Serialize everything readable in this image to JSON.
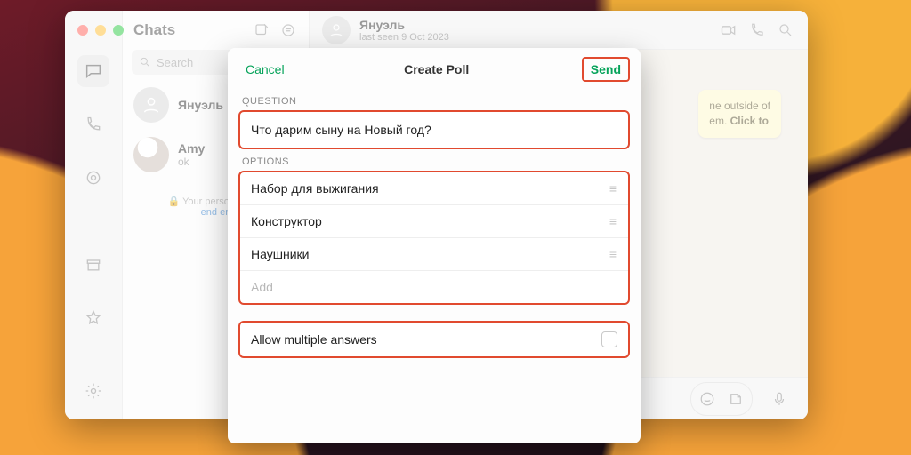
{
  "sidebar": {
    "chats_title": "Chats",
    "search_placeholder": "Search"
  },
  "chats": [
    {
      "name": "Януэль",
      "sub": ""
    },
    {
      "name": "Amy",
      "sub": "ok"
    }
  ],
  "encryption_note": {
    "lead": "Your personal mes",
    "link": "end en"
  },
  "conversation": {
    "name": "Януэль",
    "status": "last seen 9 Oct 2023",
    "tip_line1": "ne outside of",
    "tip_line2": "em. ",
    "tip_bold": "Click to"
  },
  "modal": {
    "cancel": "Cancel",
    "title": "Create Poll",
    "send": "Send",
    "question_label": "QUESTION",
    "question_value": "Что дарим сыну на Новый год?",
    "options_label": "OPTIONS",
    "options": [
      "Набор для выжигания",
      "Конструктор",
      "Наушники"
    ],
    "add_placeholder": "Add",
    "allow_multiple": "Allow multiple answers"
  }
}
